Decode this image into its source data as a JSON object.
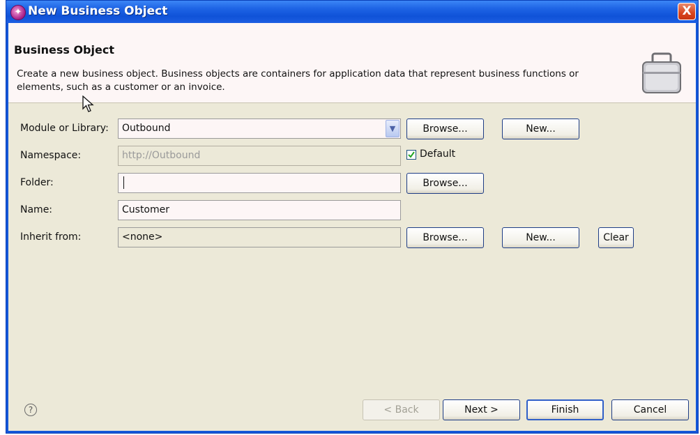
{
  "window": {
    "title": "New Business Object",
    "close_label": "X"
  },
  "header": {
    "title": "Business Object",
    "description": "Create a new business object. Business objects are containers for application data that represent business functions or elements, such as a customer or an invoice."
  },
  "form": {
    "module": {
      "label": "Module or Library:",
      "value": "Outbound",
      "browse_label": "Browse...",
      "new_label": "New..."
    },
    "namespace": {
      "label": "Namespace:",
      "value": "http://Outbound",
      "default_label": "Default",
      "default_checked": true
    },
    "folder": {
      "label": "Folder:",
      "value": "",
      "browse_label": "Browse..."
    },
    "name": {
      "label": "Name:",
      "value": "Customer"
    },
    "inherit": {
      "label": "Inherit from:",
      "value": "<none>",
      "browse_label": "Browse...",
      "new_label": "New...",
      "clear_label": "Clear"
    }
  },
  "footer": {
    "help_label": "?",
    "back_label": "< Back",
    "next_label": "Next >",
    "finish_label": "Finish",
    "cancel_label": "Cancel"
  },
  "icons": {
    "app": "business-object-wizard-icon",
    "header": "briefcase-icon",
    "combo": "chevron-down-icon",
    "help": "help-icon",
    "pointer": "mouse-pointer-icon"
  },
  "colors": {
    "titlebar": "#1e64e5",
    "client": "#ece9d8",
    "header_bg": "#fdf6f6",
    "close_button": "#d8451d",
    "button_border": "#1d3c85"
  }
}
